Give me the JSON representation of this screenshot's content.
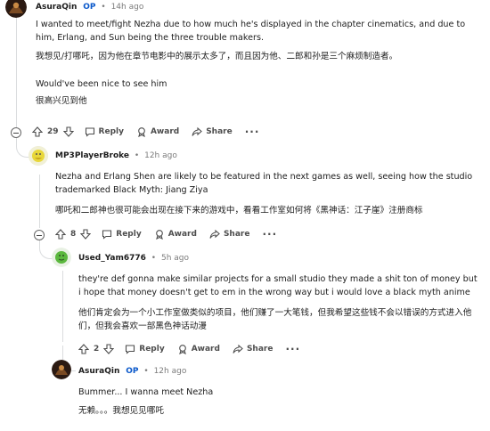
{
  "comments": [
    {
      "username": "AsuraQin",
      "op_badge": "OP",
      "time_ago": "14h ago",
      "paragraphs": [
        "I wanted to meet/fight Nezha due to how much he's displayed in the chapter cinematics, and due to him, Erlang, and Sun being the three trouble makers.",
        "我想见/打哪吒，因为他在章节电影中的展示太多了，而且因为他、二郎和孙是三个麻烦制造者。",
        "Would've been nice to see him",
        "很高兴见到他"
      ],
      "votes": "29",
      "reply_label": "Reply",
      "award_label": "Award",
      "share_label": "Share",
      "more_label": "···"
    },
    {
      "username": "MP3PlayerBroke",
      "time_ago": "12h ago",
      "paragraphs": [
        "Nezha and Erlang Shen are likely to be featured in the next games as well, seeing how the studio trademarked Black Myth: Jiang Ziya",
        "哪吒和二郎神也很可能会出现在接下来的游戏中，看看工作室如何将《黑神话：江子崖》注册商标"
      ],
      "votes": "8",
      "reply_label": "Reply",
      "award_label": "Award",
      "share_label": "Share",
      "more_label": "···"
    },
    {
      "username": "Used_Yam6776",
      "time_ago": "5h ago",
      "paragraphs": [
        "they're def gonna make similar projects for a small studio they made a shit ton of money but i hope that money doesn't get to em in the wrong way but i would love a black myth anime",
        "他们肯定会为一个小工作室做类似的项目，他们赚了一大笔钱，但我希望这些钱不会以错误的方式进入他们，但我会喜欢一部黑色神话动漫"
      ],
      "votes": "2",
      "reply_label": "Reply",
      "award_label": "Award",
      "share_label": "Share",
      "more_label": "···"
    },
    {
      "username": "AsuraQin",
      "op_badge": "OP",
      "time_ago": "12h ago",
      "paragraphs": [
        "Bummer... I wanna meet Nezha",
        "无赖。。。我想见见哪吒"
      ]
    }
  ]
}
